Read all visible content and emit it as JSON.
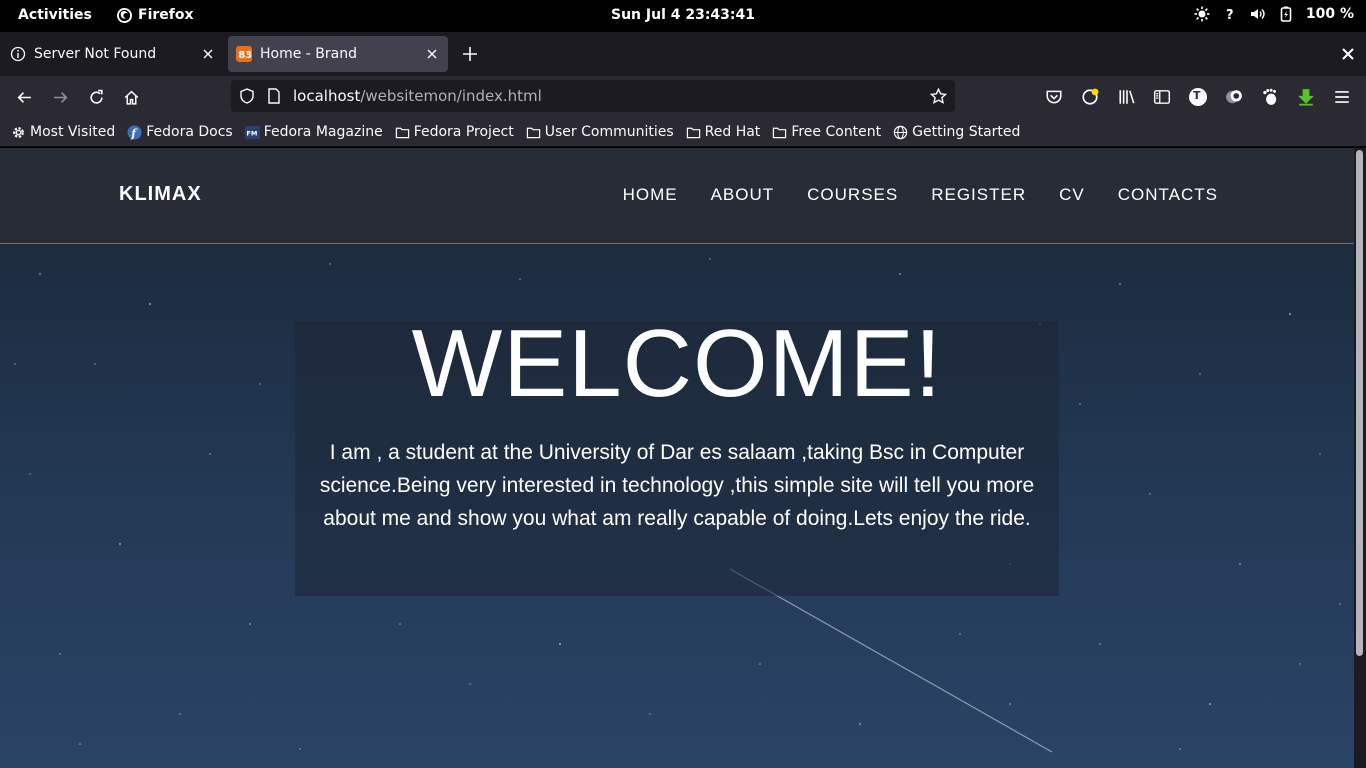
{
  "system": {
    "activities": "Activities",
    "app_name": "Firefox",
    "clock": "Sun Jul 4  23:43:41",
    "battery": "100 %"
  },
  "tabs": [
    {
      "label": "Server Not Found",
      "active": false
    },
    {
      "label": "Home - Brand",
      "active": true
    }
  ],
  "urlbar": {
    "host": "localhost",
    "path": "/websitemon/index.html"
  },
  "profile_initial": "T",
  "bookmarks": [
    {
      "label": "Most Visited",
      "icon": "gear-icon"
    },
    {
      "label": "Fedora Docs",
      "icon": "fedora-icon"
    },
    {
      "label": "Fedora Magazine",
      "icon": "fedora-magazine-icon"
    },
    {
      "label": "Fedora Project",
      "icon": "folder-icon"
    },
    {
      "label": "User Communities",
      "icon": "folder-icon"
    },
    {
      "label": "Red Hat",
      "icon": "folder-icon"
    },
    {
      "label": "Free Content",
      "icon": "folder-icon"
    },
    {
      "label": "Getting Started",
      "icon": "globe-icon"
    }
  ],
  "site": {
    "brand": "KLIMAX",
    "menu": [
      "HOME",
      "ABOUT",
      "COURSES",
      "REGISTER",
      "CV",
      "CONTACTS"
    ],
    "hero_title": "WELCOME!",
    "hero_text": "I am , a student at the University of Dar es salaam ,taking Bsc in Computer science.Being very interested in technology ,this simple site will tell you more about me and show you what am really capable of doing.Lets enjoy the ride."
  },
  "colors": {
    "system_bar": "#000000",
    "tab_strip": "#1c1b22",
    "toolbar": "#2b2a33",
    "site_nav": "#272c36",
    "hero_sky": "#243a57"
  }
}
